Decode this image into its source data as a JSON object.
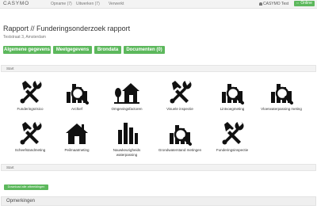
{
  "navbar": {
    "brand": "CASYMO",
    "links": [
      "Opname (7)",
      "Uitwerken (7)",
      "Verwerkt"
    ],
    "user": "CASYMO Test",
    "status": "Online",
    "status_color": "#5cb85c"
  },
  "page": {
    "title": "Rapport // Funderingsonderzoek rapport",
    "address": "Teststraat 3, Amsterdam"
  },
  "tabs": [
    "Algemene gegevens",
    "Meetgegevens",
    "Brondata",
    "Documenten (0)"
  ],
  "sections": {
    "start_top": "Start",
    "start_bottom": "Start"
  },
  "tiles": [
    {
      "label": "Funderingsrisico",
      "icon": "tools-icon"
    },
    {
      "label": "Archief",
      "icon": "bar-magnifier-icon"
    },
    {
      "label": "Omgevingsfactoren",
      "icon": "house-tree-icon"
    },
    {
      "label": "Visuele inspectie",
      "icon": "tools-icon"
    },
    {
      "label": "Lintvoegmeting",
      "icon": "bar-magnifier-icon"
    },
    {
      "label": "Vloerwaterpassing meting",
      "icon": "bar-magnifier-icon"
    },
    {
      "label": "Scheefstandmeting",
      "icon": "tools-icon"
    },
    {
      "label": "Peilmaatmeting",
      "icon": "house-icon"
    },
    {
      "label": "Nauwkeurigheids waterpassing",
      "icon": "bar-chart-icon"
    },
    {
      "label": "Grondwaterstand metingen",
      "icon": "bar-magnifier-icon"
    },
    {
      "label": "Funderingsinspectie",
      "icon": "tools-icon"
    }
  ],
  "download_button": "Download alle afbeeldingen",
  "remarks": "Opmerkingen",
  "accent_color": "#5cb85c"
}
